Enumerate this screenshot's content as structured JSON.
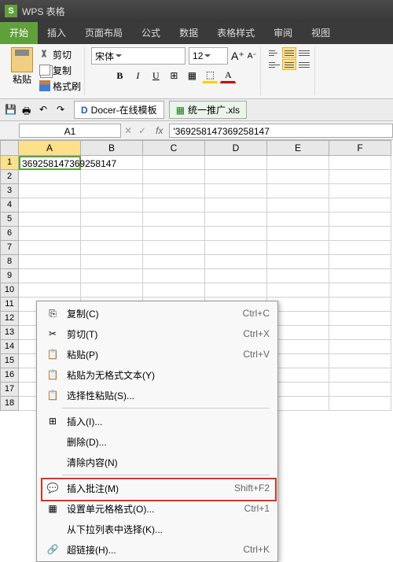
{
  "title": "WPS 表格",
  "menu": [
    "开始",
    "插入",
    "页面布局",
    "公式",
    "数据",
    "表格样式",
    "审阅",
    "视图"
  ],
  "clipboard": {
    "paste": "粘贴",
    "cut": "剪切",
    "copy": "复制",
    "brush": "格式刷"
  },
  "font": {
    "name": "宋体",
    "size": "12"
  },
  "docs": {
    "docer": "Docer-在线模板",
    "file": "统一推广.xls"
  },
  "namebox": "A1",
  "formula": "'369258147369258147",
  "cols": [
    "A",
    "B",
    "C",
    "D",
    "E",
    "F"
  ],
  "a1": "369258147369258147",
  "ctx": [
    {
      "icon": "copy",
      "label": "复制(C)",
      "key": "Ctrl+C"
    },
    {
      "icon": "cut",
      "label": "剪切(T)",
      "key": "Ctrl+X"
    },
    {
      "icon": "paste",
      "label": "粘贴(P)",
      "key": "Ctrl+V"
    },
    {
      "icon": "paste",
      "label": "粘贴为无格式文本(Y)",
      "key": ""
    },
    {
      "icon": "paste",
      "label": "选择性粘贴(S)...",
      "key": ""
    },
    {
      "sep": true
    },
    {
      "icon": "insert",
      "label": "插入(I)...",
      "key": ""
    },
    {
      "icon": "",
      "label": "删除(D)...",
      "key": ""
    },
    {
      "icon": "",
      "label": "清除内容(N)",
      "key": ""
    },
    {
      "sep": true
    },
    {
      "icon": "comment",
      "label": "插入批注(M)",
      "key": "Shift+F2"
    },
    {
      "icon": "format",
      "label": "设置单元格格式(O)...",
      "key": "Ctrl+1"
    },
    {
      "icon": "",
      "label": "从下拉列表中选择(K)...",
      "key": ""
    },
    {
      "icon": "link",
      "label": "超链接(H)...",
      "key": "Ctrl+K"
    }
  ]
}
